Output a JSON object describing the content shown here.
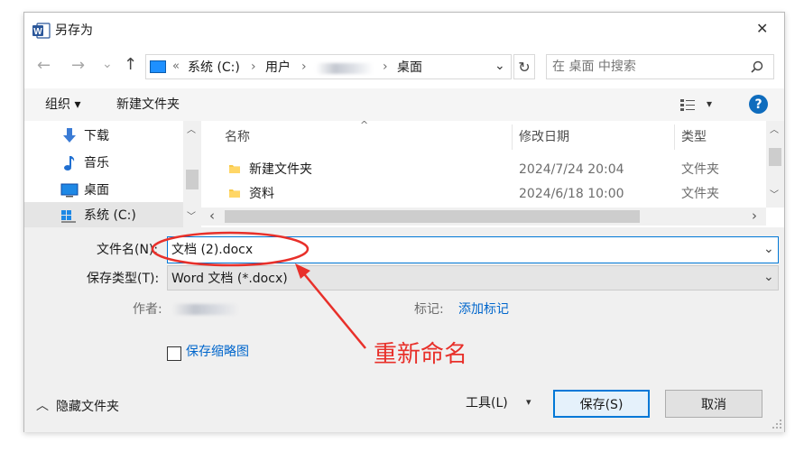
{
  "window": {
    "title": "另存为",
    "close_glyph": "✕"
  },
  "nav": {
    "back_glyph": "←",
    "forward_glyph": "→",
    "history_glyph": "⌄",
    "up_glyph": "↑",
    "breadcrumb": {
      "prefix": "«",
      "items": [
        "系统 (C:)",
        "用户",
        "桌面"
      ],
      "sep": "›"
    },
    "dropdown_glyph": "⌄",
    "refresh_glyph": "↻",
    "search_placeholder": "在 桌面 中搜索"
  },
  "toolbar": {
    "organize_label": "组织 ▾",
    "new_folder_label": "新建文件夹",
    "view_glyph": "▾",
    "help_glyph": "?"
  },
  "sidebar": {
    "items": [
      {
        "label": "下载",
        "icon": "download-icon"
      },
      {
        "label": "音乐",
        "icon": "music-icon"
      },
      {
        "label": "桌面",
        "icon": "desktop-icon"
      },
      {
        "label": "系统 (C:)",
        "icon": "drive-icon"
      }
    ]
  },
  "file_list": {
    "columns": [
      "名称",
      "修改日期",
      "类型"
    ],
    "sort_glyph": "^",
    "rows": [
      {
        "name": "新建文件夹",
        "date": "2024/7/24 20:04",
        "type": "文件夹"
      },
      {
        "name": "资料",
        "date": "2024/6/18 10:00",
        "type": "文件夹"
      }
    ]
  },
  "scroll": {
    "up": "︿",
    "down": "﹀",
    "left": "‹",
    "right": "›"
  },
  "form": {
    "filename_label": "文件名(N):",
    "filename_value": "文档 (2).docx",
    "filetype_label": "保存类型(T):",
    "filetype_value": "Word 文档 (*.docx)",
    "author_label": "作者:",
    "tags_label": "标记:",
    "tags_link": "添加标记",
    "thumbnail_label": "保存缩略图"
  },
  "footer": {
    "hide_folders_label": "隐藏文件夹",
    "tools_label": "工具(L)",
    "save_label": "保存(S)",
    "cancel_label": "取消"
  },
  "annotation": {
    "text": "重新命名",
    "color": "#e8302a"
  },
  "colors": {
    "accent": "#0078d7",
    "word_blue": "#2b579a",
    "link": "#0066cc"
  }
}
